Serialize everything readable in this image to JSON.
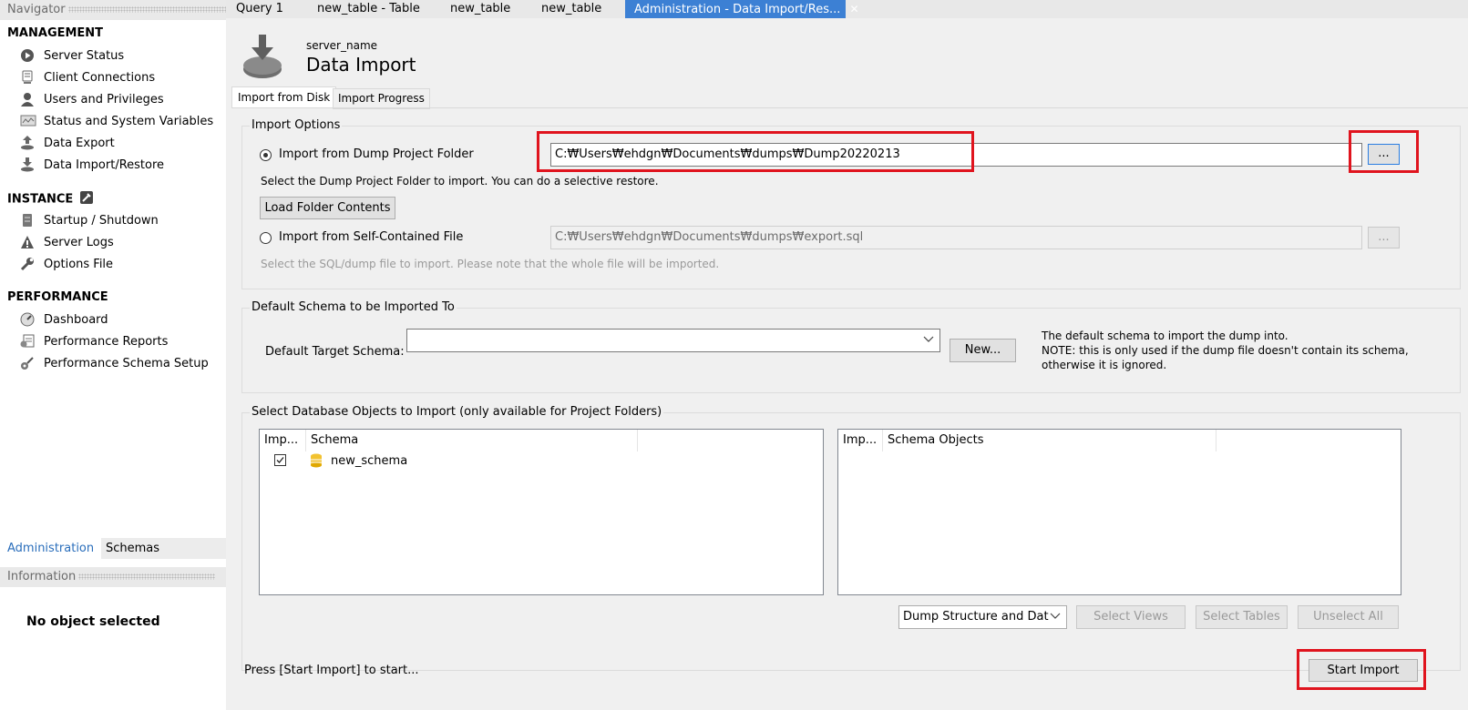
{
  "navigator": {
    "title": "Navigator",
    "management": {
      "heading": "MANAGEMENT",
      "items": [
        "Server Status",
        "Client Connections",
        "Users and Privileges",
        "Status and System Variables",
        "Data Export",
        "Data Import/Restore"
      ]
    },
    "instance": {
      "heading": "INSTANCE",
      "items": [
        "Startup / Shutdown",
        "Server Logs",
        "Options File"
      ]
    },
    "performance": {
      "heading": "PERFORMANCE",
      "items": [
        "Dashboard",
        "Performance Reports",
        "Performance Schema Setup"
      ]
    },
    "tabs": [
      "Administration",
      "Schemas"
    ],
    "info_title": "Information",
    "no_selection": "No object selected"
  },
  "editor_tabs": [
    "Query 1",
    "new_table - Table",
    "new_table",
    "new_table",
    "Administration - Data Import/Res..."
  ],
  "page": {
    "server_name": "server_name",
    "title": "Data Import",
    "subtabs": [
      "Import from Disk",
      "Import Progress"
    ]
  },
  "import_options": {
    "title": "Import Options",
    "dump_folder_label": "Import from Dump Project Folder",
    "dump_folder_path": "C:₩Users₩ehdgn₩Documents₩dumps₩Dump20220213",
    "browse_label": "...",
    "dump_folder_hint": "Select the Dump Project Folder to import. You can do a selective restore.",
    "load_button": "Load Folder Contents",
    "self_contained_label": "Import from Self-Contained File",
    "self_contained_path": "C:₩Users₩ehdgn₩Documents₩dumps₩export.sql",
    "self_contained_hint": "Select the SQL/dump file to import. Please note that the whole file will be imported."
  },
  "default_schema": {
    "title": "Default Schema to be Imported To",
    "target_label": "Default Target Schema:",
    "target_value": "",
    "new_button": "New...",
    "note": [
      "The default schema to import the dump into.",
      "NOTE: this is only used if the dump file doesn't contain its schema,",
      "otherwise it is ignored."
    ]
  },
  "objects": {
    "title": "Select Database Objects to Import (only available for Project Folders)",
    "left_headers": [
      "Imp...",
      "Schema"
    ],
    "schemas": [
      {
        "name": "new_schema",
        "checked": true
      }
    ],
    "right_headers": [
      "Imp...",
      "Schema Objects"
    ],
    "dump_select": "Dump Structure and Dat",
    "select_views": "Select Views",
    "select_tables": "Select Tables",
    "unselect_all": "Unselect All"
  },
  "footer": {
    "status": "Press [Start Import] to start...",
    "start_button": "Start Import"
  },
  "colors": {
    "accent_tab": "#3c80d4",
    "highlight_box": "#e0141e"
  }
}
